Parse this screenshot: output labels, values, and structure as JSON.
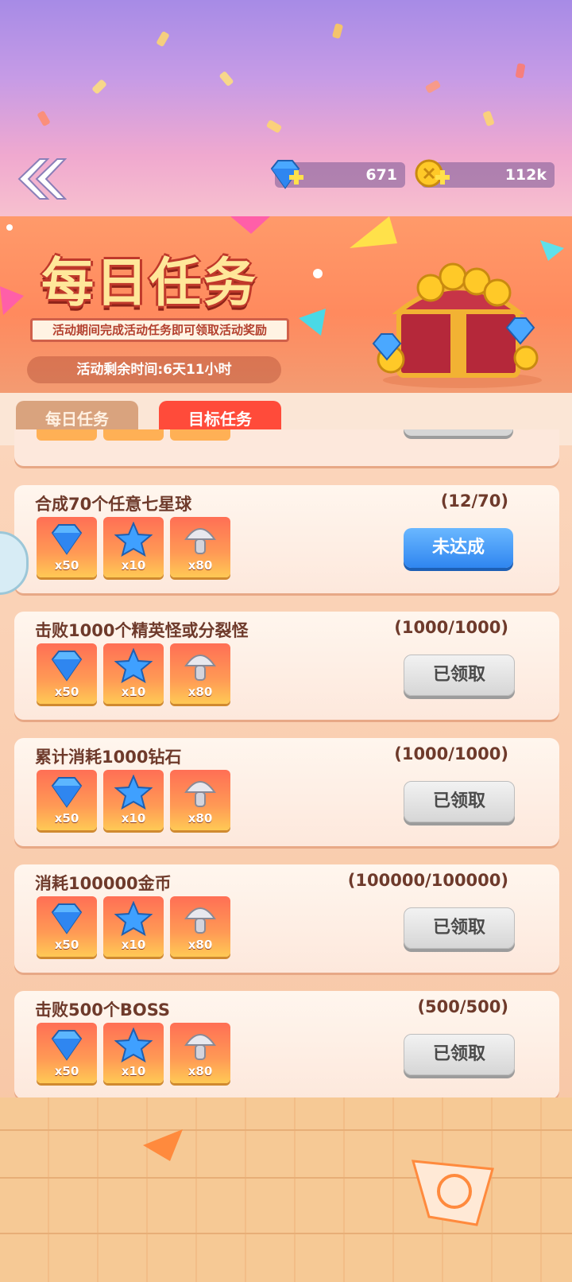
{
  "currency": {
    "gems": "671",
    "coins": "112k"
  },
  "banner": {
    "title": "每日任务",
    "subtitle": "活动期间完成活动任务即可领取活动奖励",
    "remaining_time": "活动剩余时间:6天11小时"
  },
  "tabs": [
    {
      "label": "每日任务",
      "active": false
    },
    {
      "label": "目标任务",
      "active": true
    }
  ],
  "tasks": [
    {
      "title": "合成70个任意七星球",
      "progress": "(12/70)",
      "rewards": [
        "x50",
        "x10",
        "x80"
      ],
      "button": "未达成",
      "state": "unfinished"
    },
    {
      "title": "击败1000个精英怪或分裂怪",
      "progress": "(1000/1000)",
      "rewards": [
        "x50",
        "x10",
        "x80"
      ],
      "button": "已领取",
      "state": "claimed"
    },
    {
      "title": "累计消耗1000钻石",
      "progress": "(1000/1000)",
      "rewards": [
        "x50",
        "x10",
        "x80"
      ],
      "button": "已领取",
      "state": "claimed"
    },
    {
      "title": "消耗100000金币",
      "progress": "(100000/100000)",
      "rewards": [
        "x50",
        "x10",
        "x80"
      ],
      "button": "已领取",
      "state": "claimed"
    },
    {
      "title": "击败500个BOSS",
      "progress": "(500/500)",
      "rewards": [
        "x50",
        "x10",
        "x80"
      ],
      "button": "已领取",
      "state": "claimed"
    }
  ],
  "reward_icons": [
    "diamond-icon",
    "blue-star-icon",
    "mushroom-icon"
  ],
  "colors": {
    "active_tab": "#ff4b3a",
    "unfinished_button": "#2f86f0",
    "claimed_button": "#d6d6d6",
    "title_text": "#6e3a2b"
  }
}
